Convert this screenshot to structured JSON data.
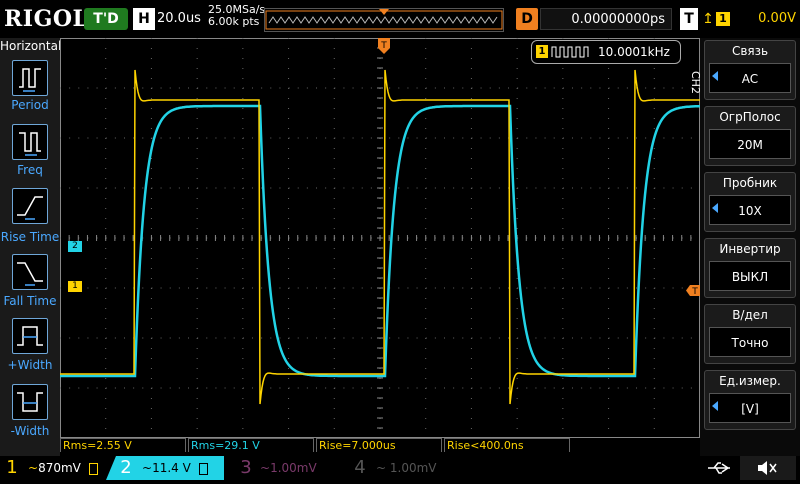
{
  "header": {
    "logo": "RIGOL",
    "trigger_status": "T'D",
    "horizontal_label": "H",
    "horizontal_scale": "20.0us",
    "sample_rate": "25.0MSa/s",
    "memory_depth": "6.00k pts",
    "delay_label": "D",
    "delay_value": "0.00000000ps",
    "trigger_label": "T",
    "trigger_source": "1",
    "trigger_level": "0.00V"
  },
  "left_menu": {
    "title": "Horizontal",
    "items": [
      {
        "label": "Period",
        "icon": "period-icon"
      },
      {
        "label": "Freq",
        "icon": "freq-icon"
      },
      {
        "label": "Rise Time",
        "icon": "rise-time-icon"
      },
      {
        "label": "Fall Time",
        "icon": "fall-time-icon"
      },
      {
        "label": "+Width",
        "icon": "pos-width-icon"
      },
      {
        "label": "-Width",
        "icon": "neg-width-icon"
      }
    ]
  },
  "freq_counter": {
    "channel": "1",
    "value": "10.0001kHz"
  },
  "right_menu": {
    "channel_tab": "CH2",
    "items": [
      {
        "title": "Связь",
        "value": "AC"
      },
      {
        "title": "ОгрПолос",
        "value": "20M"
      },
      {
        "title": "Пробник",
        "value": "10X"
      },
      {
        "title": "Инвертир",
        "value": "ВЫКЛ"
      },
      {
        "title": "В/дел",
        "value": "Точно"
      },
      {
        "title": "Ед.измер.",
        "value": "[V]"
      }
    ]
  },
  "measurements": [
    {
      "text": "Rms=2.55 V",
      "color": "#ffd400"
    },
    {
      "text": "Rms=29.1 V",
      "color": "#22d3e6"
    },
    {
      "text": "Rise=7.000us",
      "color": "#ffd400"
    },
    {
      "text": "Rise<400.0ns",
      "color": "#ffd400"
    }
  ],
  "channels": [
    {
      "num": "1",
      "scale": "870mV",
      "coupling": "~",
      "color": "#ffd400",
      "active": true
    },
    {
      "num": "2",
      "scale": "11.4 V",
      "coupling": "~",
      "color": "#22d3e6",
      "active": true
    },
    {
      "num": "3",
      "scale": "1.00mV",
      "coupling": "~",
      "color": "#7a3a6a",
      "active": false
    },
    {
      "num": "4",
      "scale": "1.00mV",
      "coupling": "~",
      "color": "#555555",
      "active": false
    }
  ],
  "markers": {
    "ch1": "1",
    "ch2": "2",
    "trigger": "T"
  },
  "colors": {
    "ch1": "#ffd400",
    "ch2": "#22d3e6",
    "accent": "#4aa8ff",
    "trigger": "#f08020"
  }
}
